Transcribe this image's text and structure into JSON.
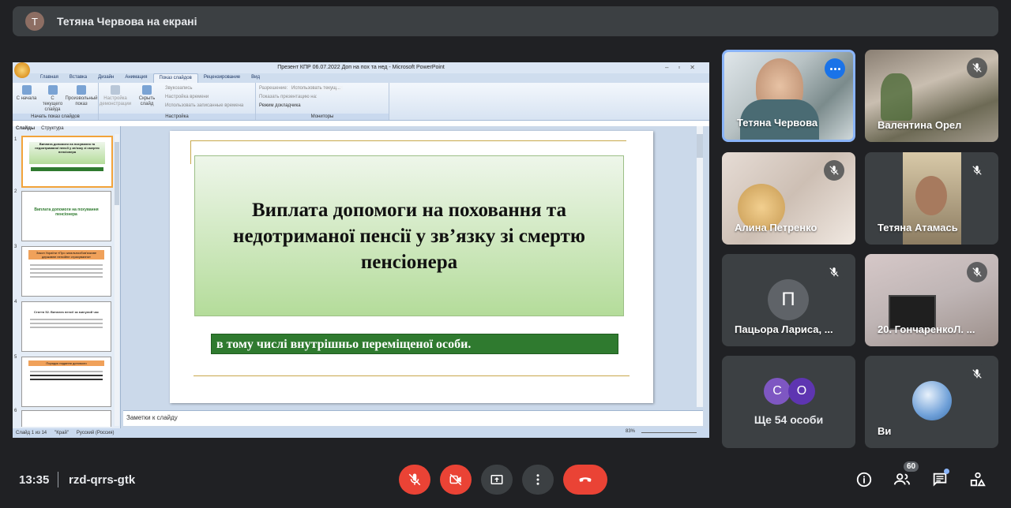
{
  "top_bar": {
    "avatar_letter": "Т",
    "presenter_text": "Тетяна Червова на екрані"
  },
  "powerpoint": {
    "window_title": "Презент КПР 06.07.2022 Доп на пох та нед - Microsoft PowerPoint",
    "tabs": [
      "Главная",
      "Вставка",
      "Дизайн",
      "Анимация",
      "Показ слайдов",
      "Рецензирование",
      "Вид"
    ],
    "active_tab": "Показ слайдов",
    "ribbon": {
      "btn_start": "С начала",
      "btn_current": "С текущего слайда",
      "btn_custom": "Произвольный показ",
      "group_start": "Начать показ слайдов",
      "btn_setup": "Настройка демонстрации",
      "btn_hide": "Скрыть слайд",
      "opt_sound": "Звукозапись",
      "opt_timing": "Настройка времени",
      "opt_use_times": "Использовать записанные времена",
      "group_setup": "Настройка",
      "opt_resolution": "Разрешение:",
      "opt_resolution_val": "Использовать текущ...",
      "opt_show_on": "Показать презентацию на:",
      "opt_presenter": "Режим докладчика",
      "group_monitors": "Мониторы"
    },
    "pane_tabs": [
      "Слайды",
      "Структура"
    ],
    "thumbs": [
      {
        "num": "1",
        "text": "Виплата допомоги на похування та недоотриманої пенсії у зв'язку зі смертю пенсіонера"
      },
      {
        "num": "2",
        "text": "Виплата допомоги на похування пенсіонера"
      },
      {
        "num": "3",
        "text": "Закон України «Про загальнообов'язкове державне пенсійне страхування»"
      },
      {
        "num": "4",
        "text": "Стаття 52. Виплата пенсії за минулий час"
      },
      {
        "num": "5",
        "text": "Порядок надання допомоги"
      },
      {
        "num": "6",
        "text": ""
      }
    ],
    "slide": {
      "title": "Виплата допомоги на поховання та недотриманої пенсії у зв’язку зі смертю пенсіонера",
      "subtitle": "в тому числі внутрішньо переміщеної особи."
    },
    "notes_placeholder": "Заметки к слайду",
    "status": {
      "slide_info": "Слайд 1 из 14",
      "theme": "\"Край\"",
      "language": "Русский (Россия)",
      "zoom": "83%"
    }
  },
  "participants": [
    {
      "name": "Тетяна Червова",
      "muted": false,
      "speaking": true
    },
    {
      "name": "Валентина Орел",
      "muted": true
    },
    {
      "name": "Алина Петренко",
      "muted": true
    },
    {
      "name": "Тетяна Атамась",
      "muted": true
    },
    {
      "name": "Пацьора Лариса, ...",
      "muted": true,
      "avatar_letter": "П"
    },
    {
      "name": "20. ГончаренкоЛ. ...",
      "muted": true
    },
    {
      "name": "Ще 54 особи",
      "avatars": [
        "С",
        "О"
      ]
    },
    {
      "name": "Ви",
      "muted": true
    }
  ],
  "bottom_bar": {
    "time": "13:35",
    "meeting_code": "rzd-qrrs-gtk",
    "people_count": "60"
  },
  "colors": {
    "background": "#202124",
    "tile": "#3c4043",
    "danger": "#ea4335",
    "accent": "#8ab4f8"
  }
}
